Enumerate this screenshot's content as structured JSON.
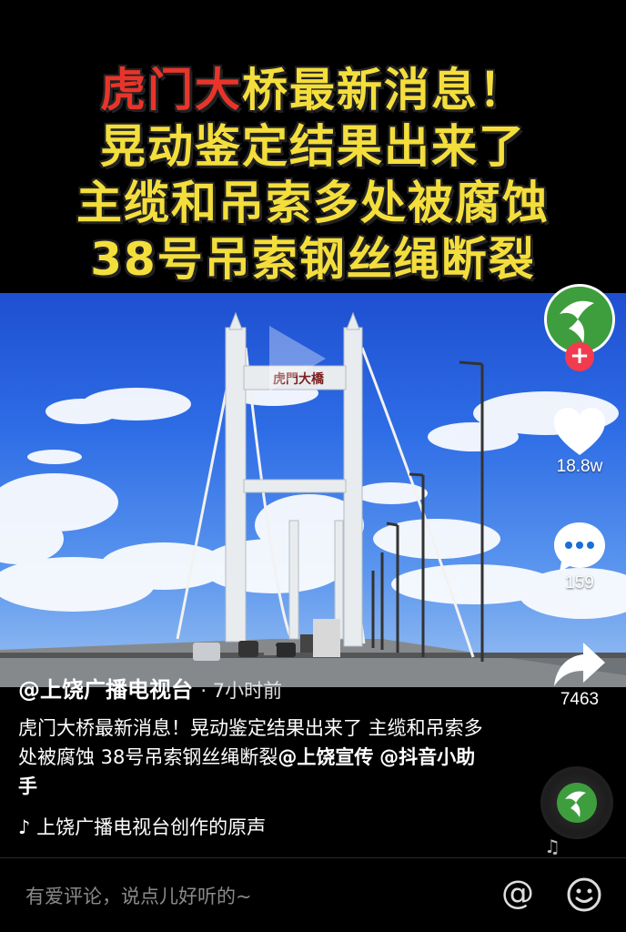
{
  "overlay_title": {
    "line1_red": "虎门大",
    "line1_rest": "桥最新消息！",
    "line2": "晃动鉴定结果出来了",
    "line3": "主缆和吊索多处被腐蚀",
    "line4": "38号吊索钢丝绳断裂"
  },
  "bridge_sign": "虎門大橋",
  "sidebar": {
    "likes": "18.8w",
    "comments": "159",
    "shares": "7463"
  },
  "author": {
    "name": "@上饶广播电视台",
    "time": "· 7小时前"
  },
  "caption": {
    "text": "虎门大桥最新消息！晃动鉴定结果出来了 主缆和吊索多处被腐蚀 38号吊索钢丝绳断裂",
    "mention1": "@上饶宣传",
    "mention2": "@抖音小助手"
  },
  "music": {
    "icon": "douyin-note",
    "label": "上饶广播电视台创作的原声"
  },
  "comment_bar": {
    "placeholder": "有爱评论，说点儿好听的~",
    "at_label": "@"
  },
  "colors": {
    "title_yellow": "#f4de3c",
    "title_red": "#e9342b",
    "follow_red": "#f23b4e"
  }
}
